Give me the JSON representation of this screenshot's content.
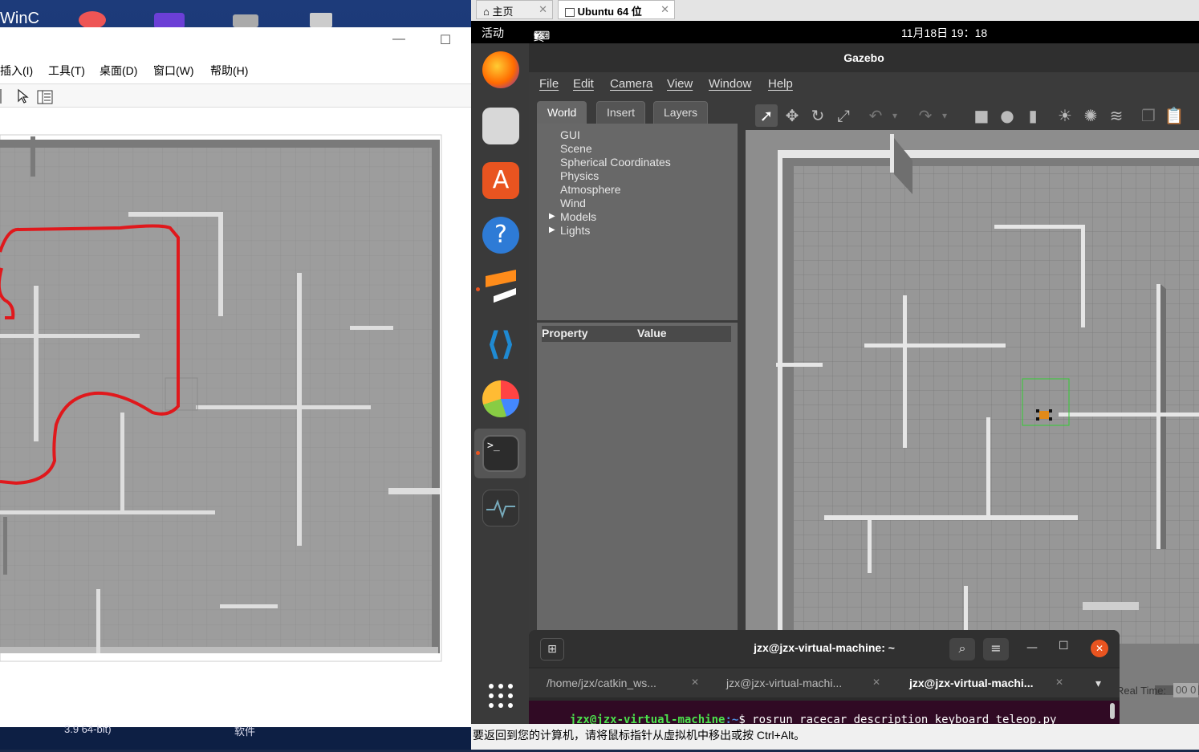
{
  "left_app": {
    "taskbar_top_icons": [
      "WinC"
    ],
    "menu": [
      "插入(I)",
      "工具(T)",
      "桌面(D)",
      "窗口(W)",
      "帮助(H)"
    ],
    "bottom_taskbar": [
      "3.9 64-bit)",
      "软件"
    ]
  },
  "vm": {
    "tabs": [
      {
        "label": "主页"
      },
      {
        "label": "Ubuntu 64 位"
      }
    ],
    "status_text": "要返回到您的计算机，请将鼠标指针从虚拟机中移出或按 Ctrl+Alt。"
  },
  "gnome": {
    "activities": "活动",
    "app_menu": "终端",
    "clock": "11月18日  19：18"
  },
  "dock_icons": [
    "firefox-icon",
    "files-icon",
    "software-center-icon",
    "help-icon",
    "sublime-icon",
    "vscode-icon",
    "pie-chart-app-icon",
    "terminal-icon",
    "system-monitor-icon",
    "show-apps-icon"
  ],
  "gazebo": {
    "title": "Gazebo",
    "menu": [
      "File",
      "Edit",
      "Camera",
      "View",
      "Window",
      "Help"
    ],
    "tabs": [
      "World",
      "Insert",
      "Layers"
    ],
    "tree": [
      "GUI",
      "Scene",
      "Spherical Coordinates",
      "Physics",
      "Atmosphere",
      "Wind",
      "Models",
      "Lights"
    ],
    "props_header": {
      "property": "Property",
      "value": "Value"
    },
    "realtime_label": "Real Time:",
    "realtime_value": "00 0"
  },
  "terminal": {
    "title": "jzx@jzx-virtual-machine: ~",
    "tabs": [
      "/home/jzx/catkin_ws...",
      "jzx@jzx-virtual-machi...",
      "jzx@jzx-virtual-machi..."
    ],
    "prompt_user": "jzx@jzx-virtual-machine",
    "prompt_path": ":~",
    "command": "$ rosrun racecar_description keyboard_teleop.py"
  }
}
